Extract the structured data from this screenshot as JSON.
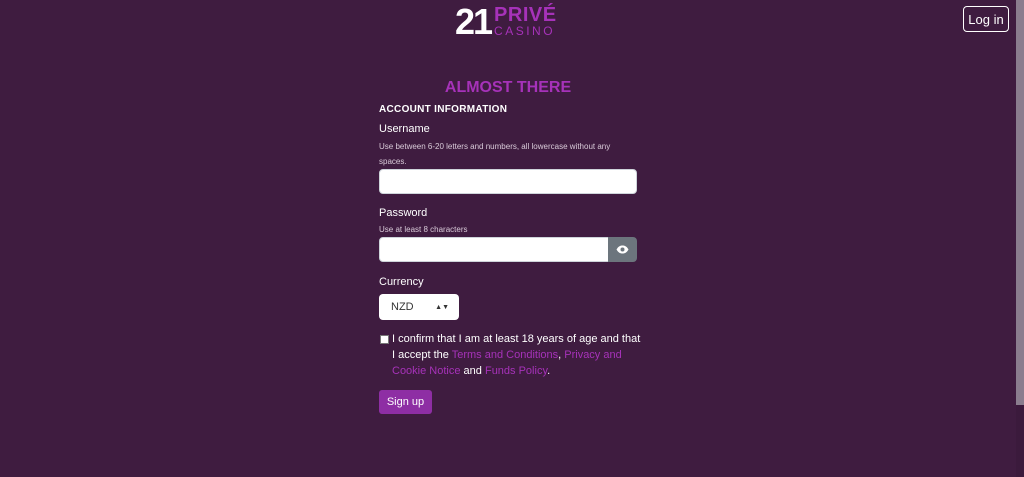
{
  "header": {
    "logo_number": "21",
    "logo_prive": "PRIVÉ",
    "logo_casino": "CASINO",
    "login_label": "Log in"
  },
  "form": {
    "title": "ALMOST THERE",
    "section": "ACCOUNT INFORMATION",
    "username": {
      "label": "Username",
      "hint": "Use between 6-20 letters and numbers, all lowercase without any spaces.",
      "value": ""
    },
    "password": {
      "label": "Password",
      "hint": "Use at least 8 characters",
      "value": ""
    },
    "currency": {
      "label": "Currency",
      "selected": "NZD"
    },
    "terms": {
      "prefix": "I confirm that I am at least 18 years of age and that I accept the",
      "link1": "Terms and Conditions",
      "sep1": ",",
      "link2": "Privacy and Cookie Notice",
      "and": "and",
      "link3": "Funds Policy",
      "end": "."
    },
    "signup_label": "Sign up"
  },
  "colors": {
    "background": "#3f1c40",
    "accent": "#a632b9",
    "button": "#8e2ea4"
  }
}
